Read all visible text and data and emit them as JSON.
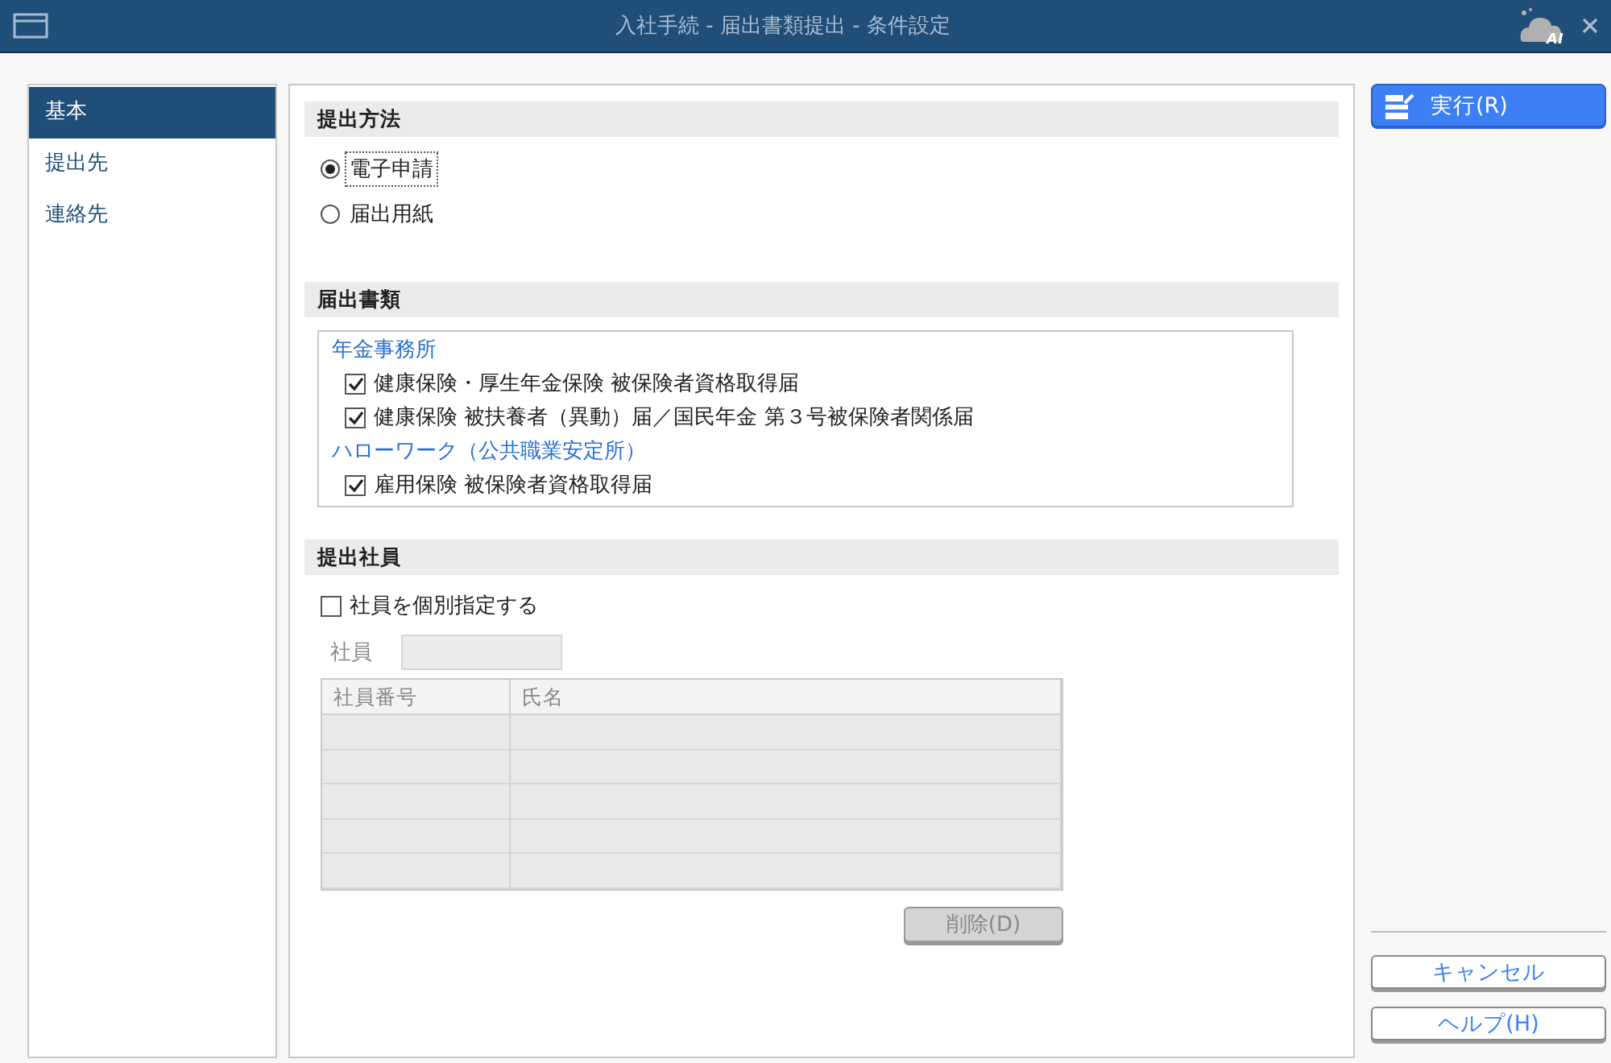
{
  "window": {
    "title": "入社手続 - 届出書類提出 - 条件設定",
    "logo_text": "AI"
  },
  "sidebar": {
    "items": [
      {
        "label": "基本",
        "selected": true
      },
      {
        "label": "提出先",
        "selected": false
      },
      {
        "label": "連絡先",
        "selected": false
      }
    ]
  },
  "submission_method": {
    "heading": "提出方法",
    "options": [
      {
        "label": "電子申請",
        "selected": true
      },
      {
        "label": "届出用紙",
        "selected": false
      }
    ]
  },
  "documents": {
    "heading": "届出書類",
    "groups": [
      {
        "label": "年金事務所",
        "items": [
          {
            "label": "健康保険・厚生年金保険 被保険者資格取得届",
            "checked": true
          },
          {
            "label": "健康保険 被扶養者（異動）届／国民年金 第３号被保険者関係届",
            "checked": true
          }
        ]
      },
      {
        "label": "ハローワーク（公共職業安定所）",
        "items": [
          {
            "label": "雇用保険 被保険者資格取得届",
            "checked": true
          }
        ]
      }
    ]
  },
  "employees": {
    "heading": "提出社員",
    "individual": {
      "label": "社員を個別指定する",
      "checked": false
    },
    "employee_field": {
      "label": "社員",
      "disabled": true
    },
    "table": {
      "columns": [
        "社員番号",
        "氏名"
      ],
      "disabled": true
    },
    "delete_button": {
      "label": "削除(D)",
      "disabled": true
    }
  },
  "actions": {
    "run": "実行(R)",
    "cancel": "キャンセル",
    "help": "ヘルプ(H)"
  }
}
